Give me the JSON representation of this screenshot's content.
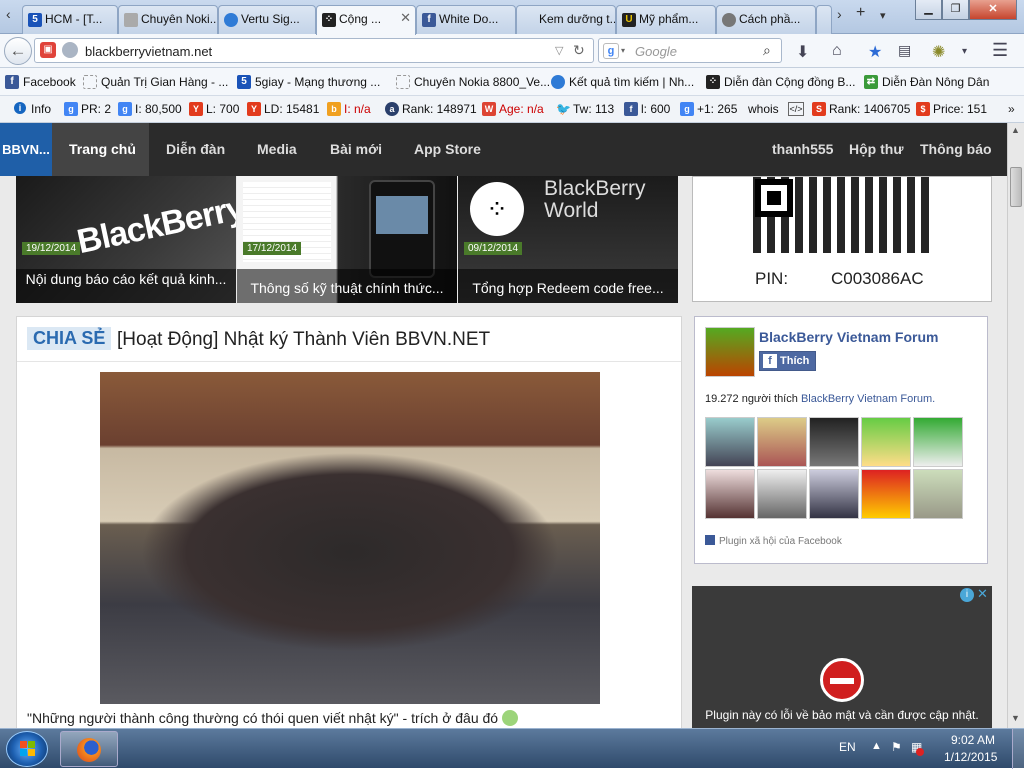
{
  "tabs": [
    {
      "label": "HCM - [T...",
      "icon": "5giay-icon",
      "color": "#1a53b8"
    },
    {
      "label": "Chuyên Noki...",
      "icon": "page-icon",
      "color": "#888888"
    },
    {
      "label": "Vertu Sig...",
      "icon": "firefox-icon",
      "color": "#2f7bd6"
    },
    {
      "label": "Cộng ...",
      "icon": "blackberry-icon",
      "color": "#222222",
      "active": true
    },
    {
      "label": "White Do...",
      "icon": "facebook-icon",
      "color": "#3b5998"
    },
    {
      "label": "Kem dưỡng t...",
      "icon": "page-icon",
      "color": "#888888"
    },
    {
      "label": "Mỹ phẩm...",
      "icon": "u-icon",
      "color": "#222222"
    },
    {
      "label": "Cách phầ...",
      "icon": "cbc-icon",
      "color": "#777777"
    }
  ],
  "url": "blackberryvietnam.net",
  "search_placeholder": "Google",
  "bookmarks": [
    {
      "label": "Facebook",
      "icon": "facebook-icon"
    },
    {
      "label": "Quản Trị Gian Hàng - ...",
      "icon": "page-icon"
    },
    {
      "label": "5giay - Mạng thương ...",
      "icon": "5giay-icon"
    },
    {
      "label": "Chuyên Nokia 8800_Ve...",
      "icon": "page-icon"
    },
    {
      "label": "Kết quả tìm kiếm | Nh...",
      "icon": "firefox-icon"
    },
    {
      "label": "Diễn đàn Cộng đồng B...",
      "icon": "blackberry-icon"
    },
    {
      "label": "Diễn Đàn Nông Dân",
      "icon": "green-icon"
    }
  ],
  "seo": [
    {
      "label": "Info",
      "icon": "info-icon"
    },
    {
      "label": "PR: 2",
      "icon": "google-icon"
    },
    {
      "label": "I: 80,500",
      "icon": "google-icon"
    },
    {
      "label": "L: 700",
      "icon": "yahoo-icon"
    },
    {
      "label": "LD: 15481",
      "icon": "yahoo-icon"
    },
    {
      "label": "I: n/a",
      "icon": "bing-icon",
      "red": true
    },
    {
      "label": "Rank: 148971",
      "icon": "alexa-icon"
    },
    {
      "label": "Age: n/a",
      "icon": "whois-icon",
      "red": true
    },
    {
      "label": "Tw: 113",
      "icon": "twitter-icon"
    },
    {
      "label": "l: 600",
      "icon": "facebook-icon"
    },
    {
      "label": "+1: 265",
      "icon": "google-icon"
    },
    {
      "label": "whois",
      "icon": ""
    },
    {
      "label": "Rank: 1406705",
      "icon": "seo-icon"
    },
    {
      "label": "Price: 151",
      "icon": "price-icon"
    }
  ],
  "site": {
    "logo": "BBVN...",
    "nav": [
      "Trang chủ",
      "Diễn đàn",
      "Media",
      "Bài mới",
      "App Store"
    ],
    "user": "thanh555",
    "inbox": "Hộp thư",
    "alerts": "Thông báo"
  },
  "slides": [
    {
      "date": "19/12/2014",
      "caption": "Nội dung báo cáo kết quả kinh..."
    },
    {
      "date": "17/12/2014",
      "caption": "Thông số kỹ thuật chính thức..."
    },
    {
      "date": "09/12/2014",
      "caption": "Tổng hợp Redeem code free..."
    }
  ],
  "qr": {
    "pin_label": "PIN:",
    "pin_value": "C003086AC"
  },
  "post": {
    "tag": "CHIA SẺ",
    "title": "[Hoạt Động] Nhật ký Thành Viên BBVN.NET",
    "quote": "\"Những người thành công thường có thói quen viết nhật ký\" - trích ở đâu đó"
  },
  "fb": {
    "page_name": "BlackBerry Vietnam Forum",
    "like_label": "Thích",
    "likes_text": "19.272 người thích",
    "likes_link": "BlackBerry Vietnam Forum.",
    "plugin_text": "Plugin xã hội của Facebook"
  },
  "ad": {
    "message": "Plugin này có lỗi về bảo mật và cần được cập nhật."
  },
  "taskbar": {
    "lang": "EN",
    "time": "9:02 AM",
    "date": "1/12/2015"
  }
}
